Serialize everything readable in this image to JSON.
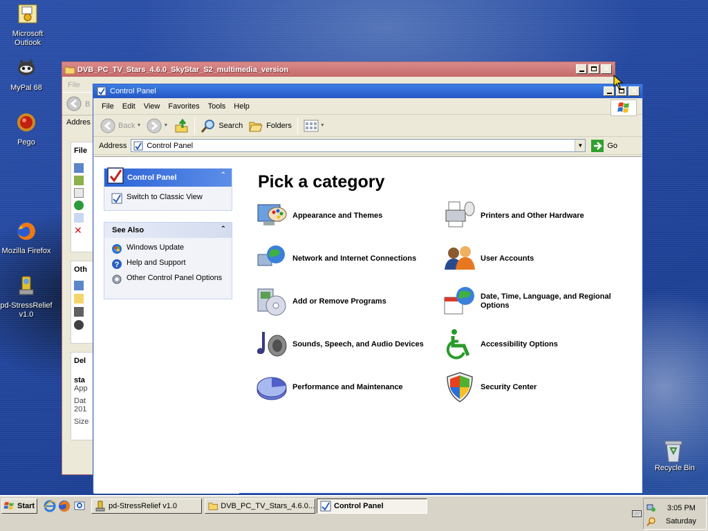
{
  "desktop": {
    "icons": [
      {
        "label": "Microsoft Outlook",
        "icon": "outlook-icon"
      },
      {
        "label": "MyPal 68",
        "icon": "mypal-icon"
      },
      {
        "label": "Pego",
        "icon": "pego-icon"
      },
      {
        "label": "Mozilla Firefox",
        "icon": "firefox-icon"
      },
      {
        "label": "pd-StressRelief v1.0",
        "icon": "stressrelief-icon"
      }
    ],
    "recycle_bin": "Recycle Bin"
  },
  "back_window": {
    "title": "DVB_PC_TV_Stars_4.6.0_SkyStar_S2_multimedia_version",
    "menu_file": "File",
    "back_label": "B",
    "address_label": "Addres",
    "pane_labels": [
      "File",
      "Oth",
      "Del"
    ],
    "details": [
      "sta",
      "App",
      "Dat",
      "201",
      "Size"
    ]
  },
  "control_panel": {
    "title": "Control Panel",
    "menu": [
      "File",
      "Edit",
      "View",
      "Favorites",
      "Tools",
      "Help"
    ],
    "toolbar": {
      "back": "Back",
      "search": "Search",
      "folders": "Folders"
    },
    "address": {
      "label": "Address",
      "value": "Control Panel",
      "go": "Go"
    },
    "side_panel": {
      "header": "Control Panel",
      "switch_view": "Switch to Classic View"
    },
    "see_also": {
      "header": "See Also",
      "items": [
        "Windows Update",
        "Help and Support",
        "Other Control Panel Options"
      ]
    },
    "heading": "Pick a category",
    "categories": [
      "Appearance and Themes",
      "Printers and Other Hardware",
      "Network and Internet Connections",
      "User Accounts",
      "Add or Remove Programs",
      "Date, Time, Language, and Regional Options",
      "Sounds, Speech, and Audio Devices",
      "Accessibility Options",
      "Performance and Maintenance",
      "Security Center"
    ]
  },
  "taskbar": {
    "start": "Start",
    "tasks": [
      "pd-StressRelief v1.0",
      "DVB_PC_TV_Stars_4.6.0...",
      "Control Panel"
    ],
    "active_task": "Control Panel",
    "clock_time": "3:05 PM",
    "clock_day": "Saturday"
  },
  "colors": {
    "xp_blue_title": "#2457c5",
    "inactive_title": "#c56a6a",
    "taskbar": "#d8d4c8",
    "desktop": "#23479f"
  }
}
